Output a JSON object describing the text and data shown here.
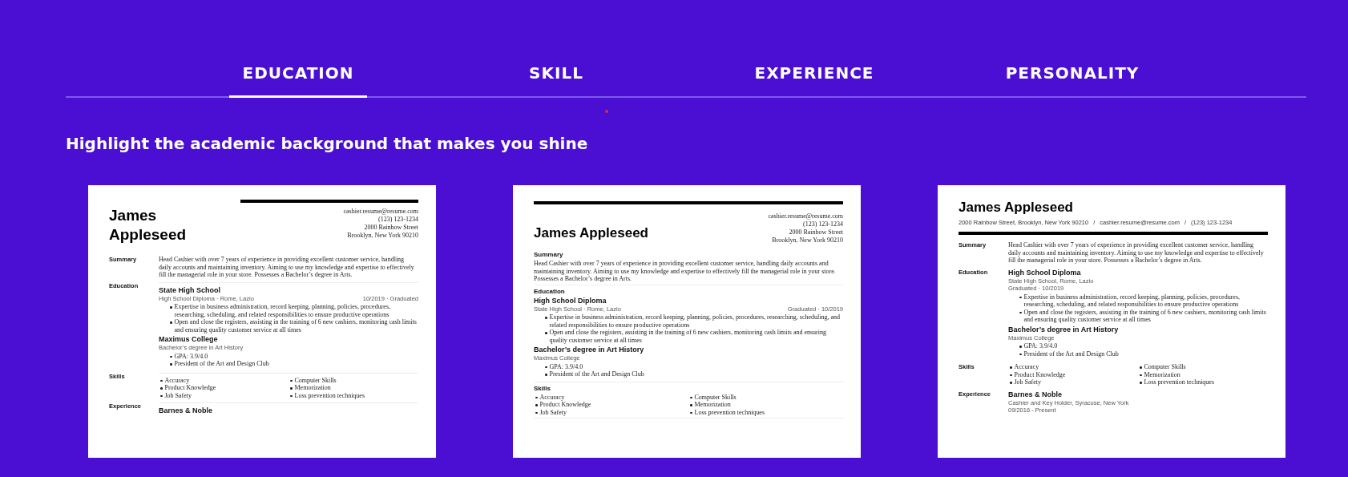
{
  "tabs": [
    {
      "label": "EDUCATION",
      "selected": true
    },
    {
      "label": "SKILL",
      "selected": false
    },
    {
      "label": "EXPERIENCE",
      "selected": false
    },
    {
      "label": "PERSONALITY",
      "selected": false
    }
  ],
  "heading": "Highlight the academic background that makes you shine",
  "resumes": [
    {
      "kind": "sidebar",
      "name": "James Appleseed",
      "contact": [
        "cashier.resume@resume.com",
        "(123) 123-1234",
        "2000 Rainbow Street",
        "Brooklyn, New York 90210"
      ],
      "sections": [
        {
          "title": "Summary",
          "kind": "text",
          "text": "Head Cashier with over 7 years of experience in providing excellent customer service, handling daily accounts and maintaining inventory. Aiming to use my knowledge and expertise to effectively fill the managerial role in your store. Possesses a Bachelor’s degree in Arts."
        },
        {
          "title": "Education",
          "kind": "entries",
          "entries": [
            {
              "title": "State High School",
              "subtitle": "High School Diploma · Rome, Lazio",
              "date": "10/2019 · Graduated",
              "bullets": [
                "Expertise in business administration, record keeping, planning, policies, procedures, researching, scheduling, and related responsibilities to ensure productive operations",
                "Open and close the registers, assisting in the training of 6 new cashiers, monitoring cash limits and ensuring quality customer service at all times"
              ]
            },
            {
              "title": "Maximus College",
              "subtitle": "Bachelor’s degree in Art History",
              "bullets": [
                "GPA: 3.9/4.0",
                "President of the Art and Design Club"
              ]
            }
          ]
        },
        {
          "title": "Skills",
          "kind": "columns",
          "columns": [
            [
              "Accuracy",
              "Product Knowledge",
              "Job Safety"
            ],
            [
              "Computer Skills",
              "Memorization",
              "Loss prevention techniques"
            ]
          ]
        },
        {
          "title": "Experience",
          "kind": "entries",
          "entries": [
            {
              "title": "Barnes & Noble"
            }
          ]
        }
      ]
    },
    {
      "kind": "banner",
      "name": "James Appleseed",
      "contact": [
        "cashier.resume@resume.com",
        "(123) 123-1234",
        "2000 Rainbow Street",
        "Brooklyn, New York 90210"
      ],
      "sections": [
        {
          "title": "Summary",
          "kind": "text",
          "text": "Head Cashier with over 7 years of experience in providing excellent customer service, handling daily accounts and maintaining inventory. Aiming to use my knowledge and expertise to effectively fill the managerial role in your store. Possesses a Bachelor’s degree in Arts."
        },
        {
          "title": "Education",
          "kind": "entries",
          "entries": [
            {
              "title": "High School Diploma",
              "subtitle": "State High School · Rome, Lazio",
              "date": "Graduated · 10/2019",
              "bullets": [
                "Expertise in business administration, record keeping, planning, policies, procedures, researching, scheduling, and related responsibilities to ensure productive operations",
                "Open and close the registers, assisting in the training of 6 new cashiers, monitoring cash limits and ensuring quality customer service at all times"
              ]
            },
            {
              "title": "Bachelor’s degree in Art History",
              "subtitle": "Maximus College",
              "bullets": [
                "GPA: 3.9/4.0",
                "President of the Art and Design Club"
              ]
            }
          ]
        },
        {
          "title": "Skills",
          "kind": "columns",
          "columns": [
            [
              "Accuracy",
              "Product Knowledge",
              "Job Safety"
            ],
            [
              "Computer Skills",
              "Memorization",
              "Loss prevention techniques"
            ]
          ]
        }
      ]
    },
    {
      "kind": "inline",
      "name": "James Appleseed",
      "separator": "/",
      "contact": [
        "2000 Rainbow Street, Brooklyn, New York 90210",
        "cashier.resume@resume.com",
        "(123) 123-1234"
      ],
      "sections": [
        {
          "title": "Summary",
          "kind": "text",
          "text": "Head Cashier with over 7 years of experience in providing excellent customer service, handling daily accounts and maintaining inventory. Aiming to use my knowledge and expertise to effectively fill the managerial role in your store. Possesses a Bachelor’s degree in Arts."
        },
        {
          "title": "Education",
          "kind": "entries",
          "entries": [
            {
              "title": "High School Diploma",
              "subtitle": "State High School, Rome, Lazio",
              "date": "Graduated · 10/2019",
              "bullets": [
                "Expertise in business administration, record keeping, planning, policies, procedures, researching, scheduling, and related responsibilities to ensure productive operations",
                "Open and close the registers, assisting in the training of 6 new cashiers, monitoring cash limits and ensuring quality customer service at all times"
              ]
            },
            {
              "title": "Bachelor’s degree in Art History",
              "subtitle": "Maximus College",
              "bullets": [
                "GPA: 3.9/4.0",
                "President of the Art and Design Club"
              ]
            }
          ]
        },
        {
          "title": "Skills",
          "kind": "columns",
          "columns": [
            [
              "Accuracy",
              "Product Knowledge",
              "Job Safety"
            ],
            [
              "Computer Skills",
              "Memorization",
              "Loss prevention techniques"
            ]
          ]
        },
        {
          "title": "Experience",
          "kind": "entries",
          "entries": [
            {
              "title": "Barnes & Noble",
              "subtitle": "Cashier and Key Holder, Syracuse, New York",
              "date": "09/2016 - Present"
            }
          ]
        }
      ]
    }
  ]
}
